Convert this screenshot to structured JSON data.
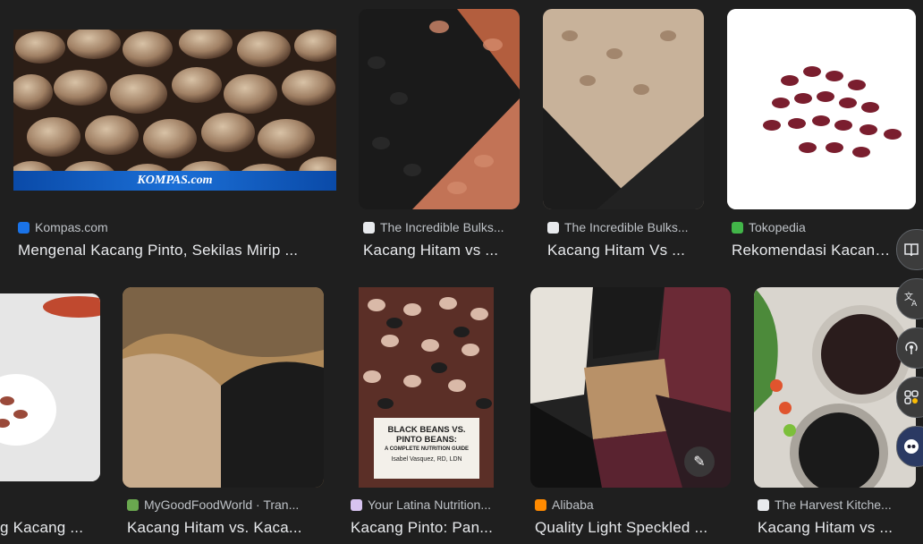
{
  "results": [
    {
      "source": "Kompas.com",
      "title": "Mengenal Kacang Pinto, Sekilas Mirip ...",
      "overlay": "KOMPAS.com"
    },
    {
      "source": "The Incredible Bulks...",
      "title": "Kacang Hitam vs ..."
    },
    {
      "source": "The Incredible Bulks...",
      "title": "Kacang Hitam Vs ..."
    },
    {
      "source": "Tokopedia",
      "title": "Rekomendasi Kacang..."
    },
    {
      "source": "",
      "title": "g Kacang ..."
    },
    {
      "source": "MyGoodFoodWorld · Tran...",
      "title": "Kacang Hitam vs. Kaca..."
    },
    {
      "source": "Your Latina Nutrition...",
      "title": "Kacang Pinto: Pan...",
      "overlay_lines": [
        "BLACK BEANS VS.",
        "PINTO BEANS:",
        "A COMPLETE NUTRITION GUIDE",
        "Isabel Vasquez, RD, LDN"
      ]
    },
    {
      "source": "Alibaba",
      "title": "Quality Light Speckled ..."
    },
    {
      "source": "The Harvest Kitche...",
      "title": "Kacang Hitam vs ..."
    }
  ],
  "side_icons": [
    "book-icon",
    "translate-icon",
    "podcast-icon",
    "apps-icon",
    "assistant-icon"
  ],
  "colors": {
    "background": "#1f1f1f",
    "source_text": "#bdc1c6",
    "title_text": "#e8eaed"
  }
}
